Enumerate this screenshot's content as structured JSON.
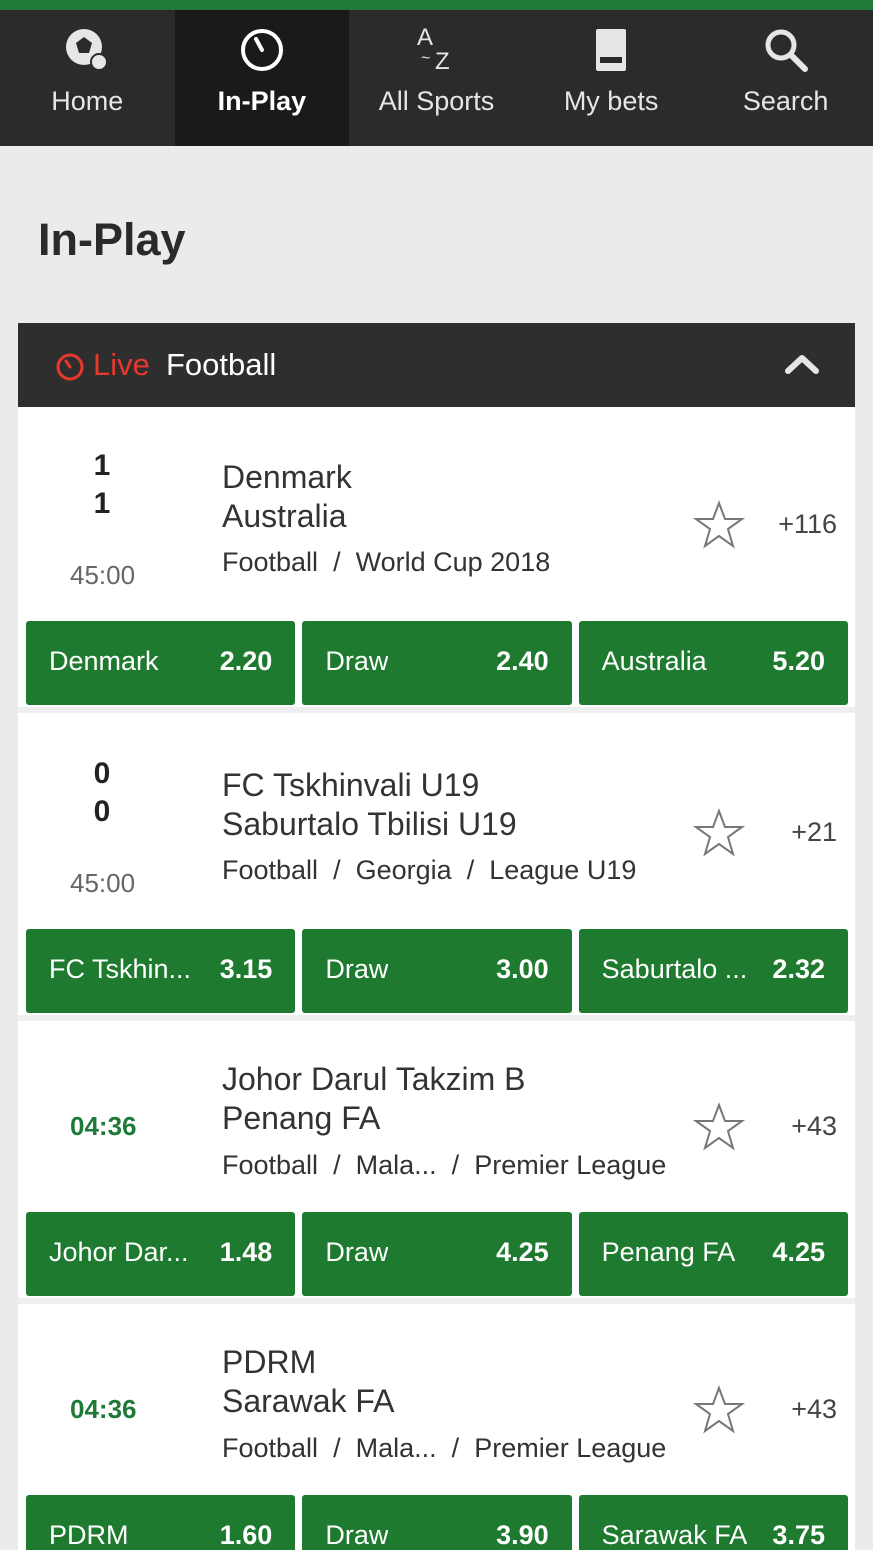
{
  "nav": {
    "items": [
      {
        "label": "Home",
        "icon": "football-icon"
      },
      {
        "label": "In-Play",
        "icon": "stopwatch-icon",
        "active": true
      },
      {
        "label": "All Sports",
        "icon": "az-sort-icon"
      },
      {
        "label": "My bets",
        "icon": "betslip-icon"
      },
      {
        "label": "Search",
        "icon": "search-icon"
      }
    ]
  },
  "page": {
    "title": "In-Play"
  },
  "section": {
    "live_label": "Live",
    "sport_label": "Football"
  },
  "events": [
    {
      "score_home": "1",
      "score_away": "1",
      "clock": "45:00",
      "home": "Denmark",
      "away": "Australia",
      "crumbs": [
        "Football",
        "World Cup 2018"
      ],
      "more": "+116",
      "odds": [
        {
          "name": "Denmark",
          "price": "2.20"
        },
        {
          "name": "Draw",
          "price": "2.40"
        },
        {
          "name": "Australia",
          "price": "5.20"
        }
      ]
    },
    {
      "score_home": "0",
      "score_away": "0",
      "clock": "45:00",
      "home": "FC Tskhinvali U19",
      "away": "Saburtalo Tbilisi U19",
      "crumbs": [
        "Football",
        "Georgia",
        "League U19"
      ],
      "more": "+21",
      "odds": [
        {
          "name": "FC Tskhin...",
          "price": "3.15"
        },
        {
          "name": "Draw",
          "price": "3.00"
        },
        {
          "name": "Saburtalo ...",
          "price": "2.32"
        }
      ]
    },
    {
      "clock": "04:36",
      "home": "Johor Darul Takzim B",
      "away": "Penang FA",
      "crumbs": [
        "Football",
        "Mala...",
        "Premier League"
      ],
      "more": "+43",
      "odds": [
        {
          "name": "Johor Dar...",
          "price": "1.48"
        },
        {
          "name": "Draw",
          "price": "4.25"
        },
        {
          "name": "Penang FA",
          "price": "4.25"
        }
      ]
    },
    {
      "clock": "04:36",
      "home": "PDRM",
      "away": "Sarawak FA",
      "crumbs": [
        "Football",
        "Mala...",
        "Premier League"
      ],
      "more": "+43",
      "odds": [
        {
          "name": "PDRM",
          "price": "1.60"
        },
        {
          "name": "Draw",
          "price": "3.90"
        },
        {
          "name": "Sarawak FA",
          "price": "3.75"
        }
      ]
    }
  ],
  "colors": {
    "brand_green": "#1e7a2e",
    "live_red": "#e8372d",
    "nav_bg": "#2b2b2b"
  }
}
